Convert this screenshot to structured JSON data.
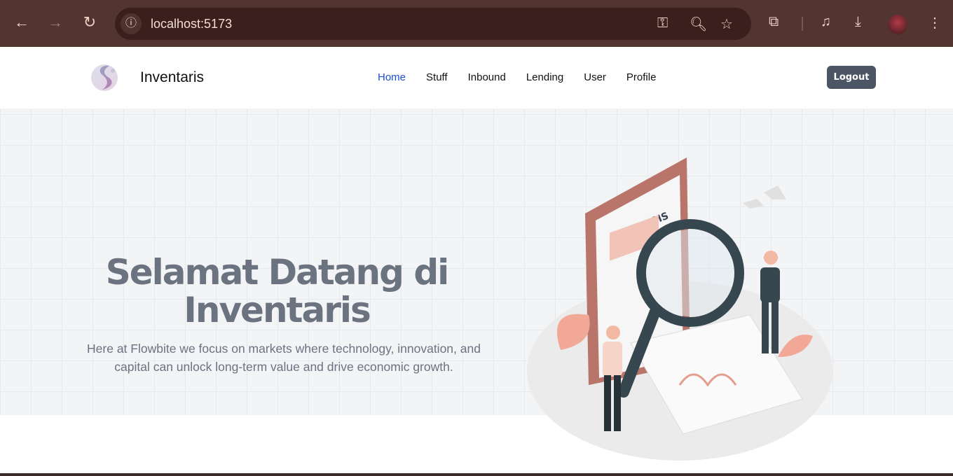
{
  "browser": {
    "url": "localhost:5173"
  },
  "navbar": {
    "brand": "Inventaris",
    "links": [
      {
        "label": "Home",
        "active": true
      },
      {
        "label": "Stuff"
      },
      {
        "label": "Inbound"
      },
      {
        "label": "Lending"
      },
      {
        "label": "User"
      },
      {
        "label": "Profile"
      }
    ],
    "logout_label": "Logout",
    "active_color": "#1d4ed8"
  },
  "hero": {
    "title": "Selamat Datang di Inventaris",
    "subtitle": "Here at Flowbite we focus on markets where technology, innovation, and capital can unlock long-term value and drive economic growth.",
    "illustration_label": "ANALYSIS"
  }
}
